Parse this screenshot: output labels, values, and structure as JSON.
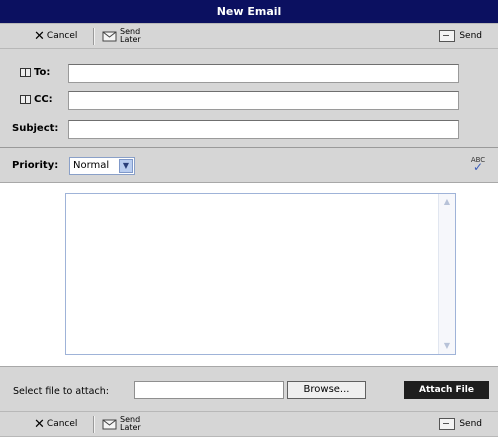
{
  "window": {
    "title": "New Email"
  },
  "toolbar": {
    "cancel_label": "Cancel",
    "send_later_line1": "Send",
    "send_later_line2": "Later",
    "send_label": "Send"
  },
  "fields": {
    "to_label": "To:",
    "to_value": "",
    "cc_label": "CC:",
    "cc_value": "",
    "subject_label": "Subject:",
    "subject_value": ""
  },
  "priority": {
    "label": "Priority:",
    "selected": "Normal"
  },
  "message": {
    "body": ""
  },
  "attachment": {
    "label": "Select file to attach:",
    "browse_label": "Browse...",
    "attach_label": "Attach File"
  },
  "icons": {
    "cancel": "close-icon",
    "send_later": "clock-envelope-icon",
    "send": "envelope-icon",
    "address_book": "address-book-icon",
    "spell_check": "spell-check-icon"
  },
  "colors": {
    "title_bar": "#0b1060",
    "panel": "#d6d6d6",
    "attach_button": "#1e1e1e"
  }
}
